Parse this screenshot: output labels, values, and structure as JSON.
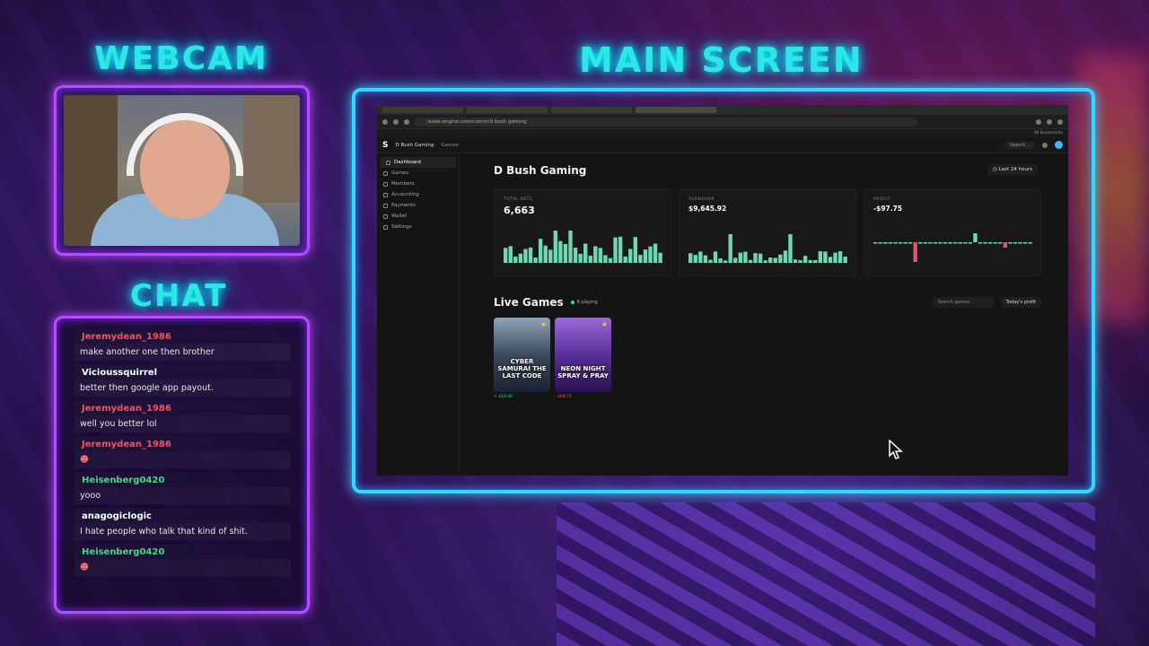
{
  "overlay": {
    "webcam_title": "WEBCAM",
    "main_title": "MAIN SCREEN",
    "chat_title": "CHAT"
  },
  "chat": {
    "messages": [
      {
        "user": "Jeremydean_1986",
        "text": "make another one then brother",
        "color": "#ff4d5e"
      },
      {
        "user": "Vicioussquirrel",
        "text": "better then google app payout.",
        "color": "#ffffff"
      },
      {
        "user": "Jeremydean_1986",
        "text": "well you better lol",
        "color": "#ff4d5e"
      },
      {
        "user": "Jeremydean_1986",
        "text": "",
        "color": "#ff4d5e"
      },
      {
        "user": "Heisenberg0420",
        "text": "yooo",
        "color": "#3ddc84"
      },
      {
        "user": "anagogiclogic",
        "text": "I hate people who talk that kind of shit.",
        "color": "#ffffff"
      },
      {
        "user": "Heisenberg0420",
        "text": "",
        "color": "#3ddc84"
      }
    ]
  },
  "browser": {
    "url": "stake.engine.com/comm/d bush gaming",
    "bookmarks": "All Bookmarks"
  },
  "app": {
    "logo": "S",
    "workspace": "D Bush Gaming",
    "section": "Games",
    "search": "Search...",
    "sidebar": [
      "Dashboard",
      "Games",
      "Members",
      "Accounting",
      "Payments",
      "Wallet",
      "Settings"
    ],
    "page_title": "D Bush Gaming",
    "range": "Last 24 hours",
    "stats": [
      {
        "label": "TOTAL BETS",
        "value": "6,663"
      },
      {
        "label": "TURNOVER",
        "value": "$9,645.92"
      },
      {
        "label": "PROFIT",
        "value": "-$97.75"
      }
    ],
    "live_title": "Live Games",
    "live_count": "8 playing",
    "games_search": "Search games...",
    "games_filter": "Today's profit",
    "games": [
      {
        "name": "CYBER SAMURAI THE LAST CODE",
        "profit": "+ $10.40",
        "profit_color": "#3ddc84"
      },
      {
        "name": "NEON NIGHT SPRAY & PRAY",
        "profit": "- $68.71",
        "profit_color": "#ff4d5e"
      }
    ]
  },
  "colors": {
    "neon_cyan": "#2ee6e6",
    "neon_purple": "#b34dff",
    "bar_green": "#6fd8b0",
    "bar_red": "#e0556a"
  }
}
